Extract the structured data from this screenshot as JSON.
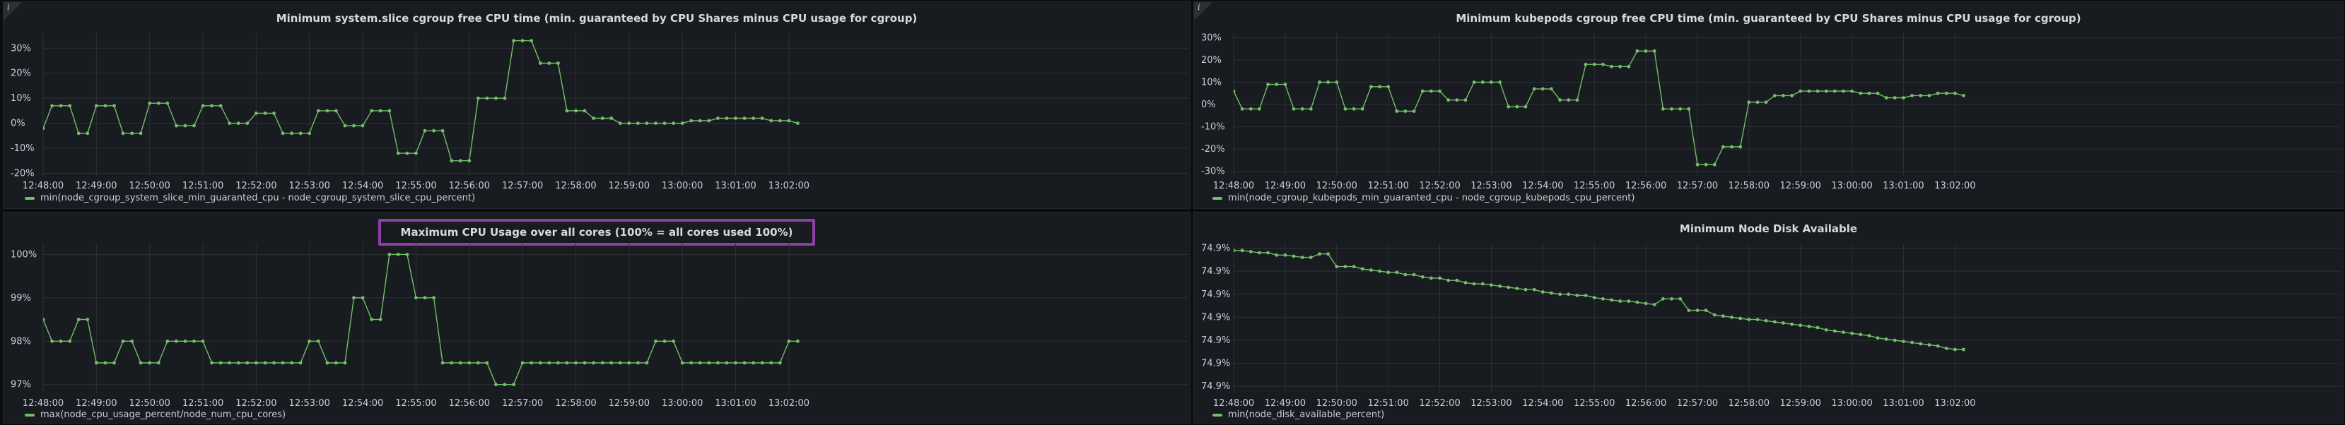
{
  "colors": {
    "series": "#73bf69"
  },
  "info_icon": "i",
  "chart_data": [
    {
      "type": "line",
      "title": "Minimum system.slice cgroup free CPU time (min. guaranteed by CPU Shares minus CPU usage for cgroup)",
      "highlight_title": false,
      "y_ticks": [
        -20,
        -10,
        0,
        10,
        20,
        30
      ],
      "y_tick_labels": [
        "-20%",
        "-10%",
        "0%",
        "10%",
        "20%",
        "30%"
      ],
      "ylim": [
        -21,
        36
      ],
      "x_range": [
        0,
        1290
      ],
      "x_ticks": [
        0,
        60,
        120,
        180,
        240,
        300,
        360,
        420,
        480,
        540,
        600,
        660,
        720,
        780,
        840
      ],
      "x_tick_labels": [
        "12:48:00",
        "12:49:00",
        "12:50:00",
        "12:51:00",
        "12:52:00",
        "12:53:00",
        "12:54:00",
        "12:55:00",
        "12:56:00",
        "12:57:00",
        "12:58:00",
        "12:59:00",
        "13:00:00",
        "13:01:00",
        "13:02:00"
      ],
      "x": [
        -10,
        0,
        10,
        20,
        30,
        40,
        50,
        60,
        70,
        80,
        90,
        100,
        110,
        120,
        130,
        140,
        150,
        160,
        170,
        180,
        190,
        200,
        210,
        220,
        230,
        240,
        250,
        260,
        270,
        280,
        290,
        300,
        310,
        320,
        330,
        340,
        350,
        360,
        370,
        380,
        390,
        400,
        410,
        420,
        430,
        440,
        450,
        460,
        470,
        480,
        490,
        500,
        510,
        520,
        530,
        540,
        550,
        560,
        570,
        580,
        590,
        600,
        610,
        620,
        630,
        640,
        650,
        660,
        670,
        680,
        690,
        700,
        710,
        720,
        730,
        740,
        750,
        760,
        770,
        780,
        790,
        800,
        810,
        820,
        830,
        840,
        850
      ],
      "series": [
        {
          "name": "min(node_cgroup_system_slice_min_guaranted_cpu - node_cgroup_system_slice_cpu_percent)",
          "values": [
            -2,
            -2,
            7,
            7,
            7,
            -4,
            -4,
            7,
            7,
            7,
            -4,
            -4,
            -4,
            8,
            8,
            8,
            -1,
            -1,
            -1,
            7,
            7,
            7,
            0,
            0,
            0,
            4,
            4,
            4,
            -4,
            -4,
            -4,
            -4,
            5,
            5,
            5,
            -1,
            -1,
            -1,
            5,
            5,
            5,
            -12,
            -12,
            -12,
            -3,
            -3,
            -3,
            -15,
            -15,
            -15,
            10,
            10,
            10,
            10,
            33,
            33,
            33,
            24,
            24,
            24,
            5,
            5,
            5,
            2,
            2,
            2,
            0,
            0,
            0,
            0,
            0,
            0,
            0,
            0,
            1,
            1,
            1,
            2,
            2,
            2,
            2,
            2,
            2,
            1,
            1,
            1,
            0
          ]
        }
      ]
    },
    {
      "type": "line",
      "title": "Minimum kubepods cgroup free CPU time (min. guaranteed by CPU Shares minus CPU usage for cgroup)",
      "highlight_title": false,
      "y_ticks": [
        -30,
        -20,
        -10,
        0,
        10,
        20,
        30
      ],
      "y_tick_labels": [
        "-30%",
        "-20%",
        "-10%",
        "0%",
        "10%",
        "20%",
        "30%"
      ],
      "ylim": [
        -32,
        32
      ],
      "x_range": [
        0,
        1290
      ],
      "x_ticks": [
        0,
        60,
        120,
        180,
        240,
        300,
        360,
        420,
        480,
        540,
        600,
        660,
        720,
        780,
        840
      ],
      "x_tick_labels": [
        "12:48:00",
        "12:49:00",
        "12:50:00",
        "12:51:00",
        "12:52:00",
        "12:53:00",
        "12:54:00",
        "12:55:00",
        "12:56:00",
        "12:57:00",
        "12:58:00",
        "12:59:00",
        "13:00:00",
        "13:01:00",
        "13:02:00"
      ],
      "x": [
        -10,
        0,
        10,
        20,
        30,
        40,
        50,
        60,
        70,
        80,
        90,
        100,
        110,
        120,
        130,
        140,
        150,
        160,
        170,
        180,
        190,
        200,
        210,
        220,
        230,
        240,
        250,
        260,
        270,
        280,
        290,
        300,
        310,
        320,
        330,
        340,
        350,
        360,
        370,
        380,
        390,
        400,
        410,
        420,
        430,
        440,
        450,
        460,
        470,
        480,
        490,
        500,
        510,
        520,
        530,
        540,
        550,
        560,
        570,
        580,
        590,
        600,
        610,
        620,
        630,
        640,
        650,
        660,
        670,
        680,
        690,
        700,
        710,
        720,
        730,
        740,
        750,
        760,
        770,
        780,
        790,
        800,
        810,
        820,
        830,
        840,
        850
      ],
      "series": [
        {
          "name": "min(node_cgroup_kubepods_min_guaranted_cpu - node_cgroup_kubepods_cpu_percent)",
          "values": [
            6,
            6,
            -2,
            -2,
            -2,
            9,
            9,
            9,
            -2,
            -2,
            -2,
            10,
            10,
            10,
            -2,
            -2,
            -2,
            8,
            8,
            8,
            -3,
            -3,
            -3,
            6,
            6,
            6,
            2,
            2,
            2,
            10,
            10,
            10,
            10,
            -1,
            -1,
            -1,
            7,
            7,
            7,
            2,
            2,
            2,
            18,
            18,
            18,
            17,
            17,
            17,
            24,
            24,
            24,
            -2,
            -2,
            -2,
            -2,
            -27,
            -27,
            -27,
            -19,
            -19,
            -19,
            1,
            1,
            1,
            4,
            4,
            4,
            6,
            6,
            6,
            6,
            6,
            6,
            6,
            5,
            5,
            5,
            3,
            3,
            3,
            4,
            4,
            4,
            5,
            5,
            5,
            4
          ]
        }
      ]
    },
    {
      "type": "line",
      "title": "Maximum CPU Usage over all cores (100% = all cores used 100%)",
      "highlight_title": true,
      "y_ticks": [
        97,
        98,
        99,
        100
      ],
      "y_tick_labels": [
        "97%",
        "98%",
        "99%",
        "100%"
      ],
      "ylim": [
        96.8,
        100.25
      ],
      "x_range": [
        0,
        1290
      ],
      "x_ticks": [
        0,
        60,
        120,
        180,
        240,
        300,
        360,
        420,
        480,
        540,
        600,
        660,
        720,
        780,
        840
      ],
      "x_tick_labels": [
        "12:48:00",
        "12:49:00",
        "12:50:00",
        "12:51:00",
        "12:52:00",
        "12:53:00",
        "12:54:00",
        "12:55:00",
        "12:56:00",
        "12:57:00",
        "12:58:00",
        "12:59:00",
        "13:00:00",
        "13:01:00",
        "13:02:00"
      ],
      "x": [
        -10,
        0,
        10,
        20,
        30,
        40,
        50,
        60,
        70,
        80,
        90,
        100,
        110,
        120,
        130,
        140,
        150,
        160,
        170,
        180,
        190,
        200,
        210,
        220,
        230,
        240,
        250,
        260,
        270,
        280,
        290,
        300,
        310,
        320,
        330,
        340,
        350,
        360,
        370,
        380,
        390,
        400,
        410,
        420,
        430,
        440,
        450,
        460,
        470,
        480,
        490,
        500,
        510,
        520,
        530,
        540,
        550,
        560,
        570,
        580,
        590,
        600,
        610,
        620,
        630,
        640,
        650,
        660,
        670,
        680,
        690,
        700,
        710,
        720,
        730,
        740,
        750,
        760,
        770,
        780,
        790,
        800,
        810,
        820,
        830,
        840,
        850
      ],
      "series": [
        {
          "name": "max(node_cpu_usage_percent/node_num_cpu_cores)",
          "values": [
            98.5,
            98.5,
            98,
            98,
            98,
            98.5,
            98.5,
            97.5,
            97.5,
            97.5,
            98,
            98,
            97.5,
            97.5,
            97.5,
            98,
            98,
            98,
            98,
            98,
            97.5,
            97.5,
            97.5,
            97.5,
            97.5,
            97.5,
            97.5,
            97.5,
            97.5,
            97.5,
            97.5,
            98,
            98,
            97.5,
            97.5,
            97.5,
            99,
            99,
            98.5,
            98.5,
            100,
            100,
            100,
            99,
            99,
            99,
            97.5,
            97.5,
            97.5,
            97.5,
            97.5,
            97.5,
            97,
            97,
            97,
            97.5,
            97.5,
            97.5,
            97.5,
            97.5,
            97.5,
            97.5,
            97.5,
            97.5,
            97.5,
            97.5,
            97.5,
            97.5,
            97.5,
            97.5,
            98,
            98,
            98,
            97.5,
            97.5,
            97.5,
            97.5,
            97.5,
            97.5,
            97.5,
            97.5,
            97.5,
            97.5,
            97.5,
            97.5,
            98,
            98
          ]
        }
      ]
    },
    {
      "type": "line",
      "title": "Minimum Node Disk Available",
      "highlight_title": false,
      "y_ticks": [
        0,
        1,
        2,
        3,
        4,
        5,
        6
      ],
      "y_tick_labels": [
        "74.9%",
        "74.9%",
        "74.9%",
        "74.9%",
        "74.9%",
        "74.9%",
        "74.9%"
      ],
      "ylim": [
        -0.3,
        6.2
      ],
      "x_range": [
        0,
        1290
      ],
      "x_ticks": [
        0,
        60,
        120,
        180,
        240,
        300,
        360,
        420,
        480,
        540,
        600,
        660,
        720,
        780,
        840
      ],
      "x_tick_labels": [
        "12:48:00",
        "12:49:00",
        "12:50:00",
        "12:51:00",
        "12:52:00",
        "12:53:00",
        "12:54:00",
        "12:55:00",
        "12:56:00",
        "12:57:00",
        "12:58:00",
        "12:59:00",
        "13:00:00",
        "13:01:00",
        "13:02:00"
      ],
      "x": [
        -10,
        0,
        10,
        20,
        30,
        40,
        50,
        60,
        70,
        80,
        90,
        100,
        110,
        120,
        130,
        140,
        150,
        160,
        170,
        180,
        190,
        200,
        210,
        220,
        230,
        240,
        250,
        260,
        270,
        280,
        290,
        300,
        310,
        320,
        330,
        340,
        350,
        360,
        370,
        380,
        390,
        400,
        410,
        420,
        430,
        440,
        450,
        460,
        470,
        480,
        490,
        500,
        510,
        520,
        530,
        540,
        550,
        560,
        570,
        580,
        590,
        600,
        610,
        620,
        630,
        640,
        650,
        660,
        670,
        680,
        690,
        700,
        710,
        720,
        730,
        740,
        750,
        760,
        770,
        780,
        790,
        800,
        810,
        820,
        830,
        840,
        850
      ],
      "series": [
        {
          "name": "min(node_disk_available_percent)",
          "values": [
            5.9,
            5.9,
            5.9,
            5.85,
            5.8,
            5.8,
            5.7,
            5.7,
            5.65,
            5.6,
            5.6,
            5.75,
            5.75,
            5.2,
            5.2,
            5.2,
            5.1,
            5.05,
            5.0,
            4.95,
            4.95,
            4.85,
            4.85,
            4.75,
            4.7,
            4.7,
            4.6,
            4.6,
            4.5,
            4.45,
            4.45,
            4.4,
            4.35,
            4.3,
            4.25,
            4.2,
            4.2,
            4.1,
            4.05,
            4.0,
            4.0,
            3.95,
            3.95,
            3.85,
            3.8,
            3.75,
            3.7,
            3.7,
            3.65,
            3.6,
            3.55,
            3.8,
            3.8,
            3.8,
            3.3,
            3.3,
            3.3,
            3.1,
            3.05,
            3.0,
            2.95,
            2.9,
            2.9,
            2.85,
            2.8,
            2.75,
            2.7,
            2.65,
            2.6,
            2.55,
            2.45,
            2.4,
            2.35,
            2.3,
            2.25,
            2.2,
            2.1,
            2.05,
            2.0,
            1.95,
            1.9,
            1.85,
            1.8,
            1.75,
            1.65,
            1.6,
            1.6
          ]
        }
      ]
    }
  ]
}
